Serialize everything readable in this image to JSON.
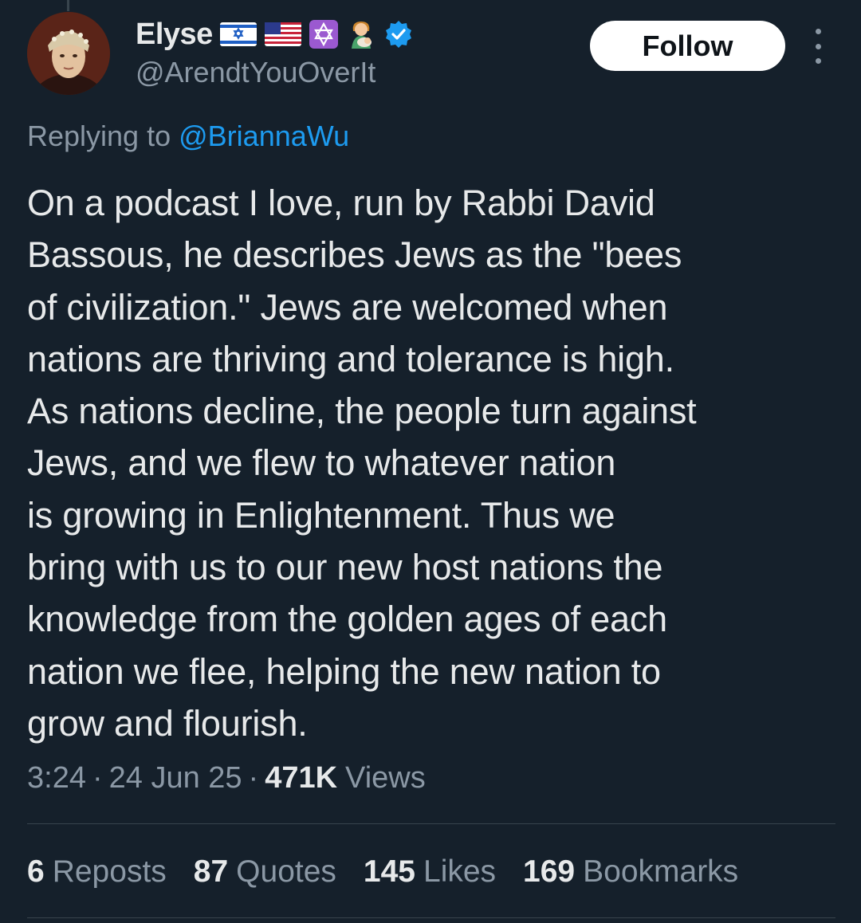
{
  "user": {
    "display_name": "Elyse",
    "handle": "@ArendtYouOverIt",
    "verified": true,
    "name_emojis": [
      "israel-flag",
      "usa-flag",
      "star-of-david",
      "woman-feeding-baby"
    ]
  },
  "follow_label": "Follow",
  "reply": {
    "prefix": "Replying to",
    "target": "@BriannaWu"
  },
  "tweet": {
    "text": "On a podcast I love, run by Rabbi David\nBassous, he describes Jews as the \"bees\nof civilization.\" Jews are welcomed when\nnations are thriving and tolerance is high.\nAs nations decline, the people turn against\nJews, and we flew to whatever nation\nis growing in Enlightenment. Thus we\nbring with us to our new host nations the\nknowledge from the golden ages of each\nnation we flee, helping the new nation to\ngrow and flourish."
  },
  "meta": {
    "time": "3:24",
    "separator": "·",
    "date": "24 Jun 25",
    "views_count": "471K",
    "views_label": "Views"
  },
  "stats": {
    "reposts_count": "6",
    "reposts_label": "Reposts",
    "quotes_count": "87",
    "quotes_label": "Quotes",
    "likes_count": "145",
    "likes_label": "Likes",
    "bookmarks_count": "169",
    "bookmarks_label": "Bookmarks"
  },
  "colors": {
    "background": "#15202b",
    "text": "#e7e9ea",
    "secondary": "#8b98a5",
    "link": "#1d9bf0",
    "divider": "#38444d"
  }
}
